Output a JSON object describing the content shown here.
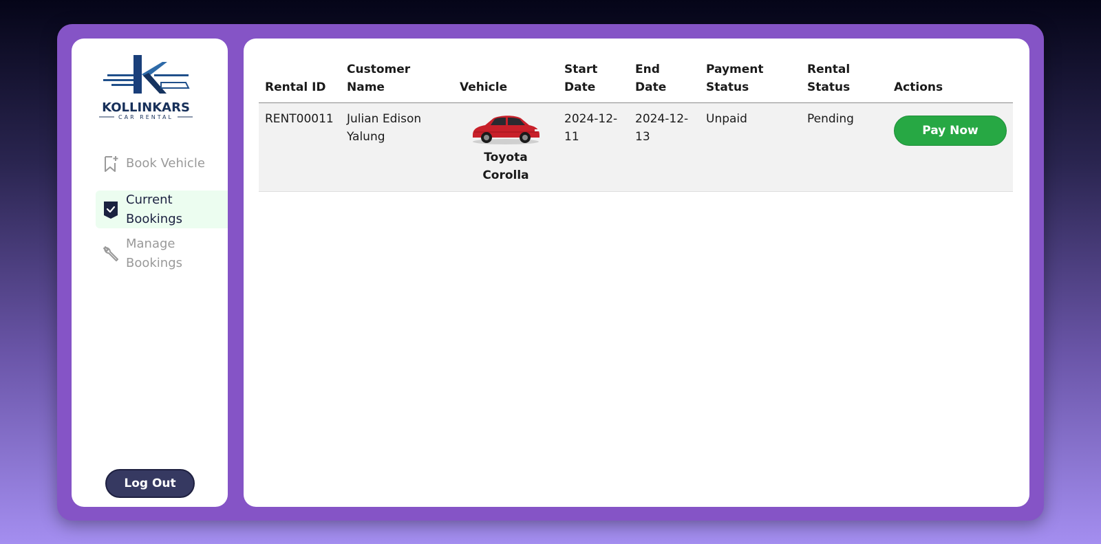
{
  "brand": {
    "name": "KOLLINKARS",
    "tagline": "CAR RENTAL",
    "colors": {
      "primary": "#1f4f8a",
      "frame": "#8554c6",
      "accent": "#27a844"
    }
  },
  "sidebar": {
    "items": [
      {
        "label": "Book Vehicle",
        "icon": "bookmark-plus-icon",
        "active": false
      },
      {
        "label": "Current Bookings",
        "icon": "shield-check-icon",
        "active": true
      },
      {
        "label": "Manage Bookings",
        "icon": "wrench-icon",
        "active": false
      }
    ],
    "logout_label": "Log Out"
  },
  "table": {
    "headers": [
      "Rental ID",
      "Customer Name",
      "Vehicle",
      "Start Date",
      "End Date",
      "Payment Status",
      "Rental Status",
      "Actions"
    ],
    "rows": [
      {
        "rental_id": "RENT00011",
        "customer_name": "Julian Edison Yalung",
        "vehicle": "Toyota Corolla",
        "vehicle_image": "red-sedan-car-image",
        "start_date": "2024-12-11",
        "end_date": "2024-12-13",
        "payment_status": "Unpaid",
        "rental_status": "Pending",
        "action_label": "Pay Now"
      }
    ]
  }
}
